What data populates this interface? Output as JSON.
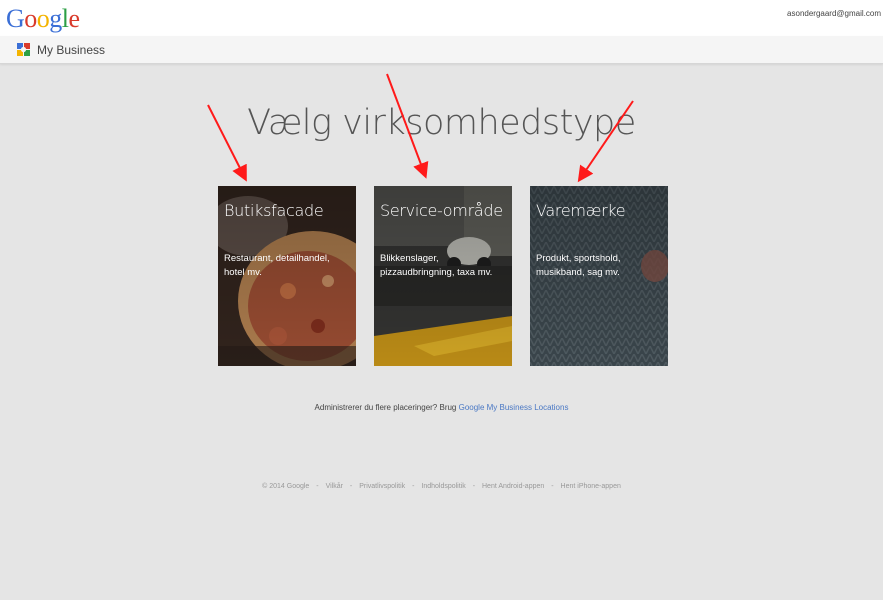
{
  "header": {
    "logo_letters": [
      "G",
      "o",
      "o",
      "g",
      "l",
      "e"
    ],
    "logo_colors": [
      "#3b6fd6",
      "#d93a2b",
      "#f4b400",
      "#3b6fd6",
      "#2c9f45",
      "#d93a2b"
    ],
    "account_email": "asondergaard@gmail.com"
  },
  "product": {
    "icon": "my-business-icon",
    "name": "My Business"
  },
  "main": {
    "heading": "Vælg virksomhedstype",
    "cards": [
      {
        "title": "Butiksfacade",
        "description": "Restaurant, detailhandel, hotel mv."
      },
      {
        "title": "Service-område",
        "description": "Blikkenslager, pizzaudbringning, taxa mv."
      },
      {
        "title": "Varemærke",
        "description": "Produkt, sportshold, musikband, sag mv."
      }
    ],
    "locations_text": "Administrerer du flere placeringer? Brug",
    "locations_link": "Google My Business Locations"
  },
  "footer": {
    "items": [
      "© 2014 Google",
      "Vilkår",
      "Privatlivspolitik",
      "Indholdspolitik",
      "Hent Android-appen",
      "Hent iPhone-appen"
    ],
    "separator": "-"
  },
  "annotations": {
    "arrow_color": "#ff1a1a",
    "arrow_count": 3
  }
}
